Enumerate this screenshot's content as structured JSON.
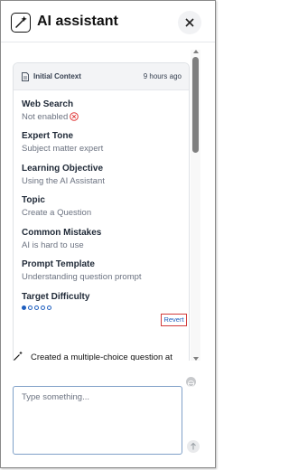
{
  "header": {
    "title": "AI assistant",
    "logo_icon": "magic-wand-icon",
    "close_icon": "close-icon"
  },
  "context": {
    "label": "Initial Context",
    "time": "9 hours ago",
    "items": [
      {
        "title": "Web Search",
        "value": "Not enabled"
      },
      {
        "title": "Expert Tone",
        "value": "Subject matter expert"
      },
      {
        "title": "Learning Objective",
        "value": "Using the AI Assistant"
      },
      {
        "title": "Topic",
        "value": "Create a Question"
      },
      {
        "title": "Common Mistakes",
        "value": "AI is hard to use"
      },
      {
        "title": "Prompt Template",
        "value": "Understanding question prompt"
      },
      {
        "title": "Target Difficulty",
        "value": ""
      }
    ],
    "difficulty_level": 1,
    "difficulty_max": 5,
    "revert_label": "Revert"
  },
  "message": {
    "text": "Created a multiple-choice question at"
  },
  "composer": {
    "placeholder": "Type something..."
  },
  "colors": {
    "accent": "#1f5fbf",
    "revert_border": "#d23b3b",
    "error": "#e03a3a"
  }
}
